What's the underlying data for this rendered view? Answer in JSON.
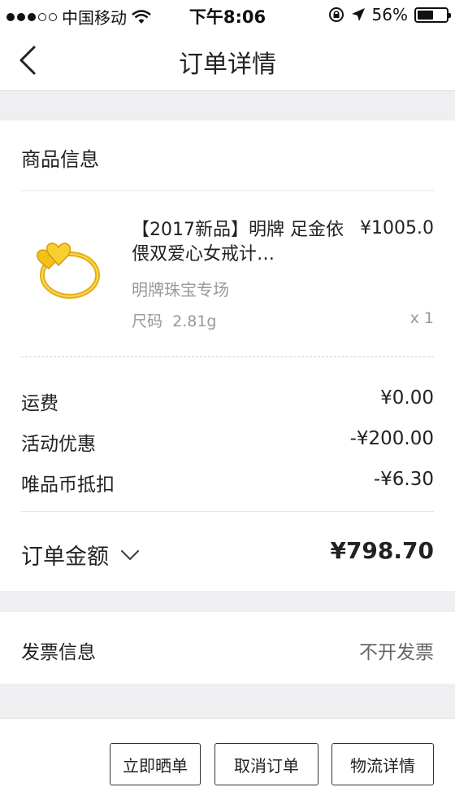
{
  "status_bar": {
    "carrier": "中国移动",
    "time": "下午8:06",
    "battery": "56%",
    "battery_level": 0.56
  },
  "nav": {
    "title": "订单详情"
  },
  "goods": {
    "section_title": "商品信息",
    "product": {
      "name": "【2017新品】明牌 足金依偎双爱心女戒计…",
      "price": "¥1005.0",
      "shop": "明牌珠宝专场",
      "size_label": "尺码",
      "size_value": "2.81g",
      "quantity": "x 1"
    },
    "fees": [
      {
        "label": "运费",
        "value": "¥0.00"
      },
      {
        "label": "活动优惠",
        "value": "-¥200.00"
      },
      {
        "label": "唯品币抵扣",
        "value": "-¥6.30"
      }
    ],
    "total_label": "订单金额",
    "total_value": "¥798.70"
  },
  "invoice": {
    "label": "发票信息",
    "value": "不开发票"
  },
  "actions": {
    "share": "立即晒单",
    "cancel": "取消订单",
    "logistics": "物流详情"
  },
  "colors": {
    "background": "#efeff1",
    "gold": "#f2c21b"
  }
}
